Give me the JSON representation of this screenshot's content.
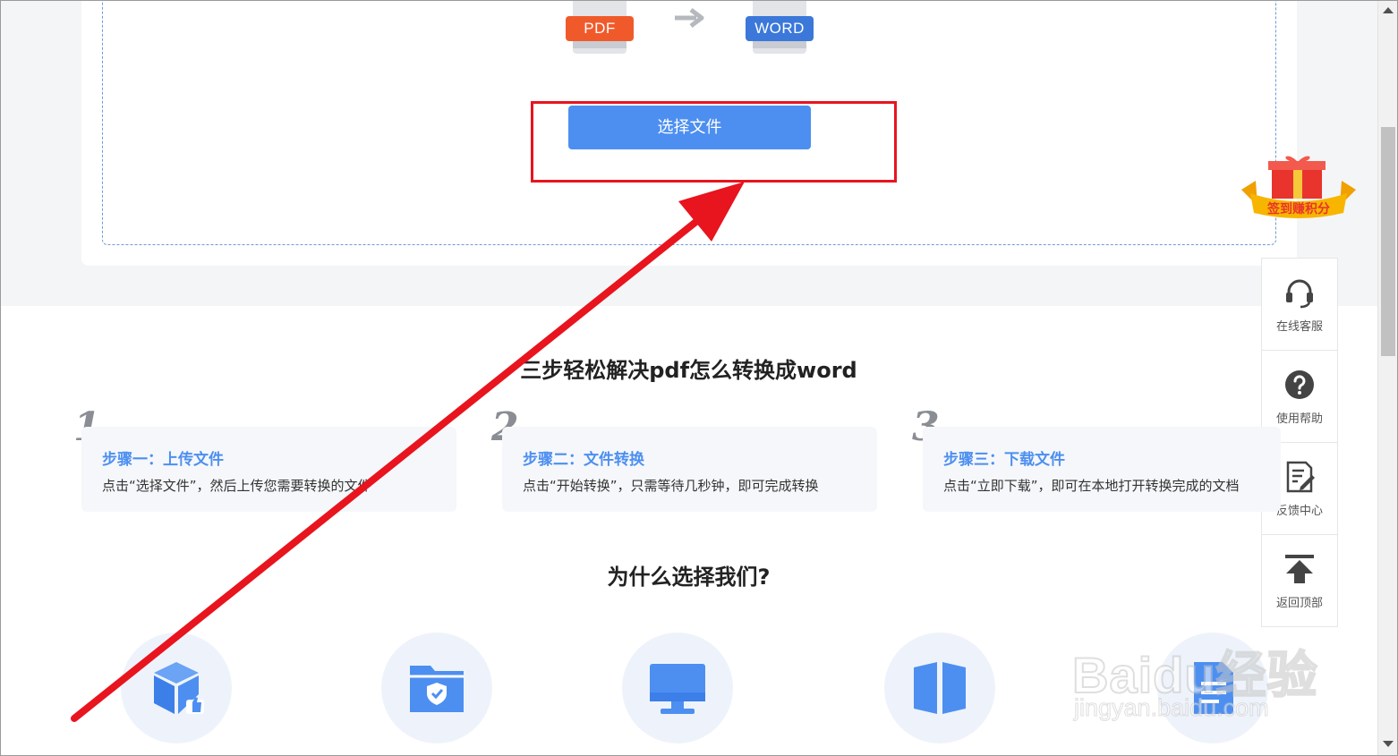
{
  "converter": {
    "from_label": "PDF",
    "to_label": "WORD",
    "choose_button": "选择文件"
  },
  "gift_badge": {
    "label": "签到赚积分"
  },
  "side_toolbar": {
    "items": [
      {
        "icon": "headset-icon",
        "label": "在线客服"
      },
      {
        "icon": "help-icon",
        "label": "使用帮助"
      },
      {
        "icon": "feedback-icon",
        "label": "反馈中心"
      },
      {
        "icon": "back-to-top-icon",
        "label": "返回顶部"
      }
    ]
  },
  "steps_section": {
    "title": "三步轻松解决pdf怎么转换成word",
    "steps": [
      {
        "number": "1",
        "title": "步骤一：上传文件",
        "desc": "点击“选择文件”，然后上传您需要转换的文件"
      },
      {
        "number": "2",
        "title": "步骤二：文件转换",
        "desc": "点击“开始转换”，只需等待几秒钟，即可完成转换"
      },
      {
        "number": "3",
        "title": "步骤三：下载文件",
        "desc": "点击“立即下载”，即可在本地打开转换完成的文档"
      }
    ]
  },
  "why_section": {
    "title": "为什么选择我们?",
    "features": [
      "box-thumbs-up-icon",
      "secure-folder-icon",
      "monitor-icon",
      "book-icon",
      "document-icon"
    ]
  },
  "watermark": {
    "brand": "Baidu经验",
    "url": "jingyan.baidu.com"
  },
  "colors": {
    "accent": "#4d8ff0",
    "pdf": "#f05a2b",
    "word": "#3b78d9",
    "annotation": "#e8141e"
  }
}
